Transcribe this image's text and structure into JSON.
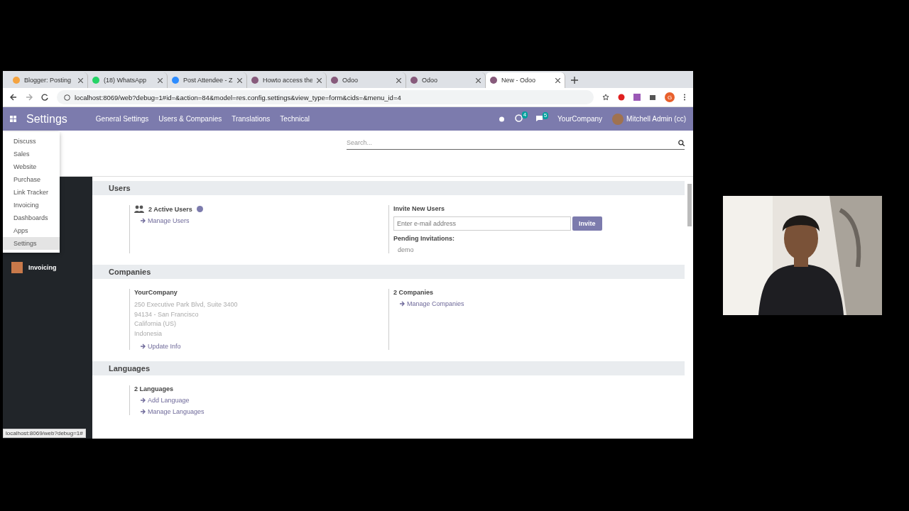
{
  "browser": {
    "tabs": [
      {
        "title": "Blogger: Posting",
        "color": "#f4a340",
        "selected": false
      },
      {
        "title": "(18) WhatsApp",
        "color": "#25d366",
        "selected": false
      },
      {
        "title": "Post Attendee - Z",
        "color": "#2d8cff",
        "selected": false
      },
      {
        "title": "Howto access the",
        "color": "#875a7b",
        "selected": false
      },
      {
        "title": "Odoo",
        "color": "#875a7b",
        "selected": false
      },
      {
        "title": "Odoo",
        "color": "#875a7b",
        "selected": false
      },
      {
        "title": "New - Odoo",
        "color": "#875a7b",
        "selected": true
      }
    ],
    "url": "localhost:8069/web?debug=1#id=&action=84&model=res.config.settings&view_type=form&cids=&menu_id=4",
    "profile_initial": "G",
    "status_url": "localhost:8069/web?debug=1#"
  },
  "navbar": {
    "app_title": "Settings",
    "menu": [
      "General Settings",
      "Users & Companies",
      "Translations",
      "Technical"
    ],
    "activity_count": "4",
    "message_count": "5",
    "company": "YourCompany",
    "user": "Mitchell Admin (cc)"
  },
  "apps_menu": [
    {
      "label": "Discuss",
      "selected": false
    },
    {
      "label": "Sales",
      "selected": false
    },
    {
      "label": "Website",
      "selected": false
    },
    {
      "label": "Purchase",
      "selected": false
    },
    {
      "label": "Link Tracker",
      "selected": false
    },
    {
      "label": "Invoicing",
      "selected": false
    },
    {
      "label": "Dashboards",
      "selected": false
    },
    {
      "label": "Apps",
      "selected": false
    },
    {
      "label": "Settings",
      "selected": true
    }
  ],
  "search": {
    "placeholder": "Search..."
  },
  "sidebar": [
    {
      "label": "Invoicing",
      "color": "#c8794a"
    }
  ],
  "sections": [
    {
      "title": "Users",
      "left": {
        "kind": "users",
        "heading": "2 Active Users",
        "links": [
          "Manage Users"
        ]
      },
      "right": {
        "kind": "invite",
        "heading": "Invite New Users",
        "placeholder": "Enter e-mail address",
        "button": "Invite",
        "pending_label": "Pending Invitations:",
        "pending": [
          "demo"
        ]
      }
    },
    {
      "title": "Companies",
      "left": {
        "kind": "company",
        "heading": "YourCompany",
        "address": [
          "250 Executive Park Blvd, Suite 3400",
          "94134 - San Francisco",
          "California (US)",
          "Indonesia"
        ],
        "links": [
          "Update Info"
        ]
      },
      "right": {
        "kind": "links",
        "heading": "2 Companies",
        "links": [
          "Manage Companies"
        ]
      }
    },
    {
      "title": "Languages",
      "left": {
        "kind": "links",
        "heading": "2 Languages",
        "links": [
          "Add Language",
          "Manage Languages"
        ]
      }
    }
  ]
}
